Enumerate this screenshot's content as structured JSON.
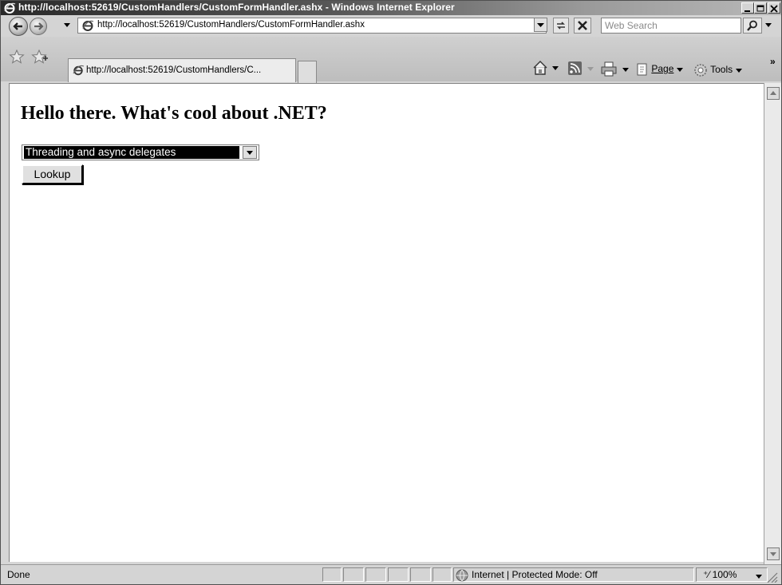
{
  "window": {
    "title": "http://localhost:52619/CustomHandlers/CustomFormHandler.ashx - Windows Internet Explorer"
  },
  "address_bar": {
    "url": "http://localhost:52619/CustomHandlers/CustomFormHandler.ashx"
  },
  "search": {
    "placeholder": "Web Search"
  },
  "tabs": [
    {
      "label": "http://localhost:52619/CustomHandlers/C..."
    }
  ],
  "command_bar": {
    "page_label": "Page",
    "tools_label": "Tools",
    "more": "»"
  },
  "page": {
    "heading": "Hello there. What's cool about .NET?",
    "select_value": "Threading and async delegates",
    "lookup_label": "Lookup"
  },
  "status_bar": {
    "status": "Done",
    "zone": "Internet | Protected Mode: Off",
    "zoom": "100%"
  }
}
